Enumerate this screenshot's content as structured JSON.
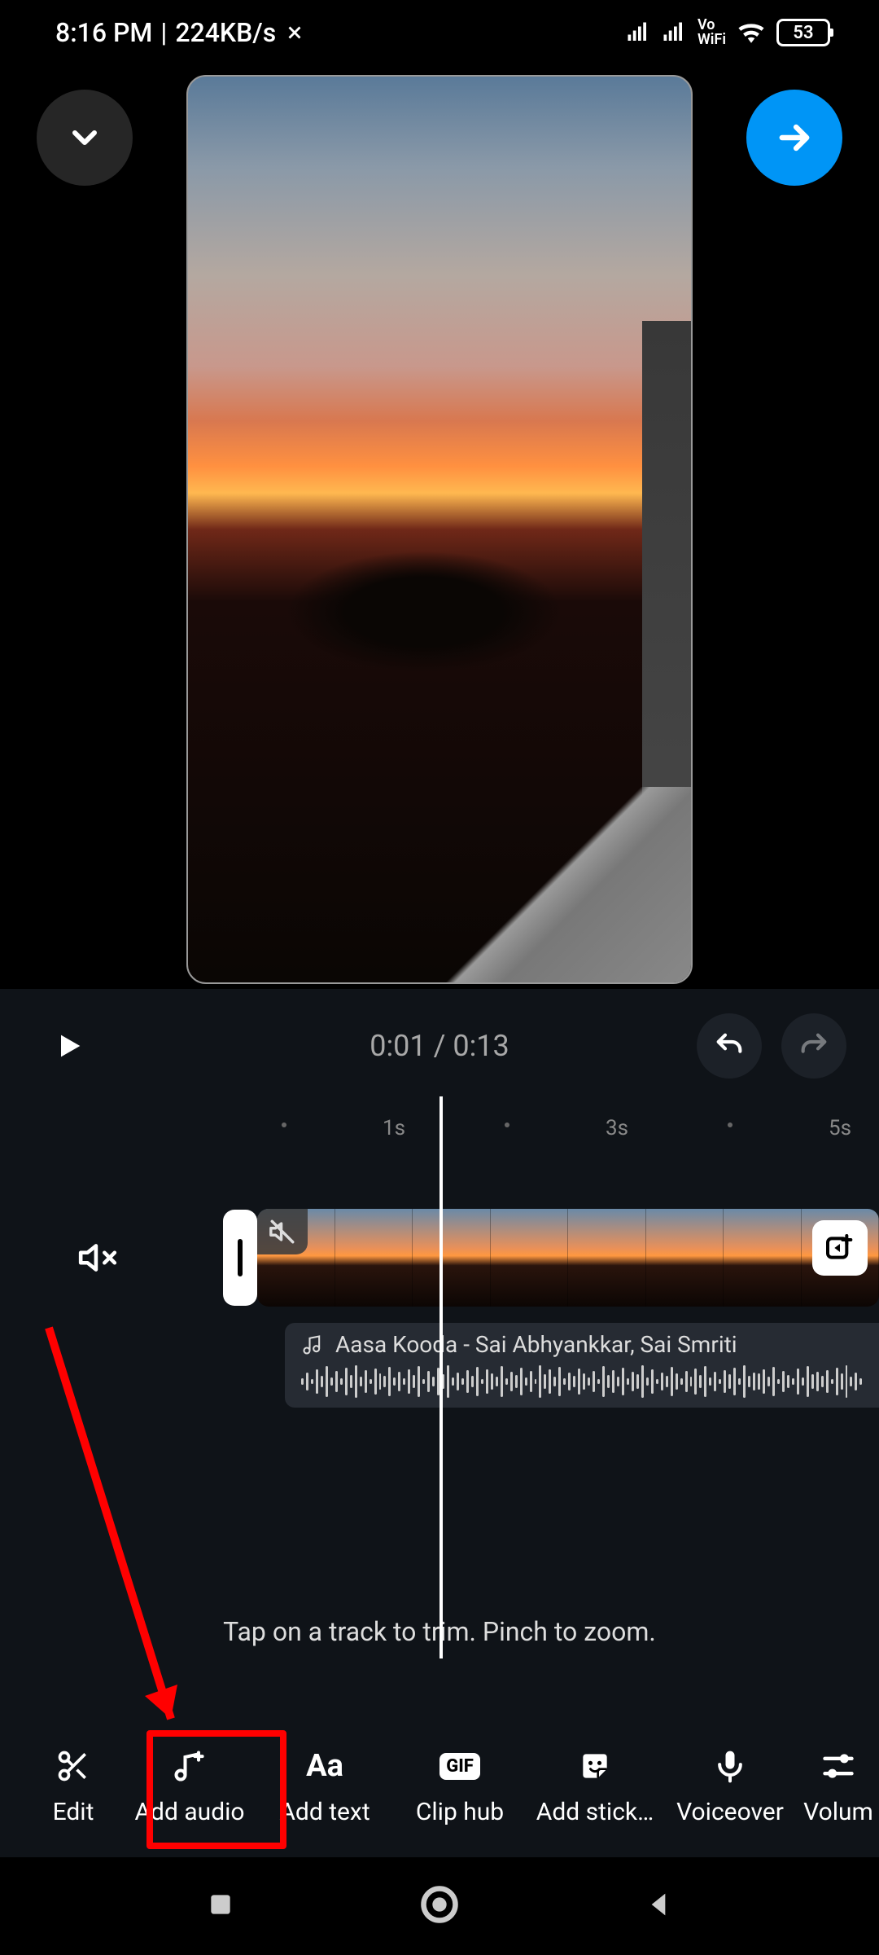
{
  "status_bar": {
    "time": "8:16 PM",
    "network_speed": "224KB/s",
    "vowifi": "Vo\nWiFi",
    "battery_percent": "53"
  },
  "header": {
    "collapse_label": "Collapse",
    "next_label": "Next"
  },
  "playback": {
    "time_display": "0:01 / 0:13"
  },
  "ruler": {
    "marks": [
      "1s",
      "3s",
      "5s"
    ]
  },
  "audio_track": {
    "title": "Aasa Kooda - Sai Abhyankkar, Sai Smriti"
  },
  "hint": "Tap on a track to trim. Pinch to zoom.",
  "toolbar": {
    "items": [
      {
        "label": "Edit"
      },
      {
        "label": "Add audio"
      },
      {
        "label": "Add text"
      },
      {
        "label": "Clip hub"
      },
      {
        "label": "Add stick…"
      },
      {
        "label": "Voiceover"
      },
      {
        "label": "Volum"
      }
    ]
  }
}
